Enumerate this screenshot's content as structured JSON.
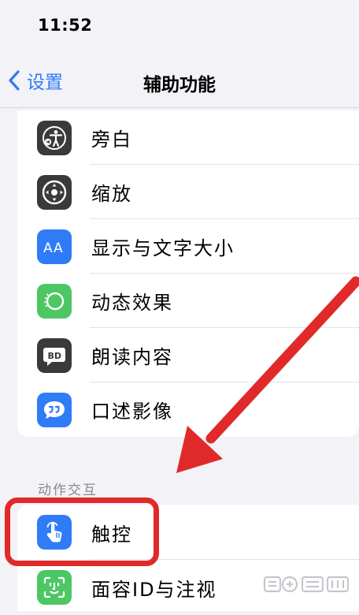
{
  "status_bar": {
    "time": "11:52"
  },
  "nav": {
    "back_label": "设置",
    "title": "辅助功能"
  },
  "vision_items": [
    {
      "label": "旁白",
      "icon": "voiceover-icon"
    },
    {
      "label": "缩放",
      "icon": "zoom-icon"
    },
    {
      "label": "显示与文字大小",
      "icon": "text-size-icon"
    },
    {
      "label": "动态效果",
      "icon": "motion-icon"
    },
    {
      "label": "朗读内容",
      "icon": "spoken-content-icon"
    },
    {
      "label": "口述影像",
      "icon": "audio-description-icon"
    }
  ],
  "interaction_section": {
    "header": "动作交互",
    "items": [
      {
        "label": "触控",
        "icon": "touch-icon"
      },
      {
        "label": "面容ID与注视",
        "icon": "face-id-icon"
      }
    ]
  },
  "annotation": {
    "highlight_color": "#e02a2a"
  },
  "colors": {
    "accent": "#2f7cf6",
    "icon_dark": "#3a3a3c",
    "icon_green": "#4cc764"
  }
}
